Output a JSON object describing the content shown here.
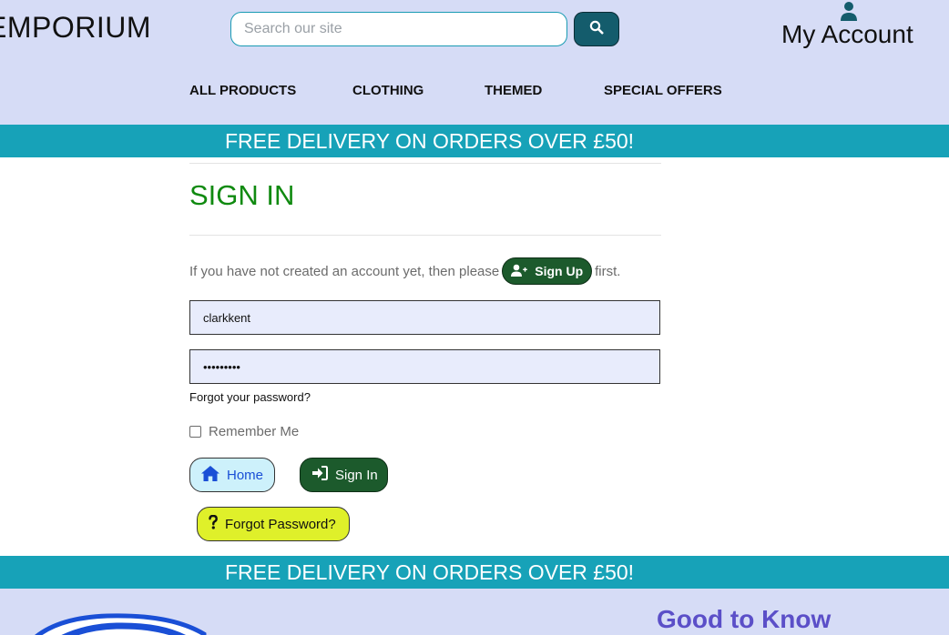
{
  "header": {
    "brand": "EMPORIUM",
    "search": {
      "placeholder": "Search our site",
      "value": ""
    },
    "account_label": "My Account"
  },
  "nav": {
    "items": [
      {
        "label": "ALL PRODUCTS"
      },
      {
        "label": "CLOTHING"
      },
      {
        "label": "THEMED"
      },
      {
        "label": "SPECIAL OFFERS"
      }
    ]
  },
  "banner": {
    "text": "FREE DELIVERY ON ORDERS OVER £50!"
  },
  "signin": {
    "title": "SIGN IN",
    "intro_before": "If you have not created an account yet, then please",
    "signup_label": "Sign Up",
    "intro_after": "first.",
    "username_value": "clarkkent",
    "password_value": "•••••••••",
    "forgot_link": "Forgot your password?",
    "remember_label": "Remember Me",
    "home_button": "Home",
    "signin_button": "Sign In",
    "forgot_button": "Forgot Password?"
  },
  "footer": {
    "heading": "Good to Know"
  },
  "colors": {
    "header_bg": "#d6dcf6",
    "banner_bg": "#17a2b8",
    "title_green": "#108a10",
    "button_dark_green": "#1c5a2c",
    "search_button_teal": "#145c6c",
    "forgot_yellow": "#dff02a",
    "home_light_blue": "#cdf1fb"
  },
  "icons": {
    "search": "search-icon",
    "account": "user-icon",
    "signup": "user-plus-icon",
    "home": "home-icon",
    "signin": "sign-in-icon",
    "forgot": "question-icon"
  }
}
